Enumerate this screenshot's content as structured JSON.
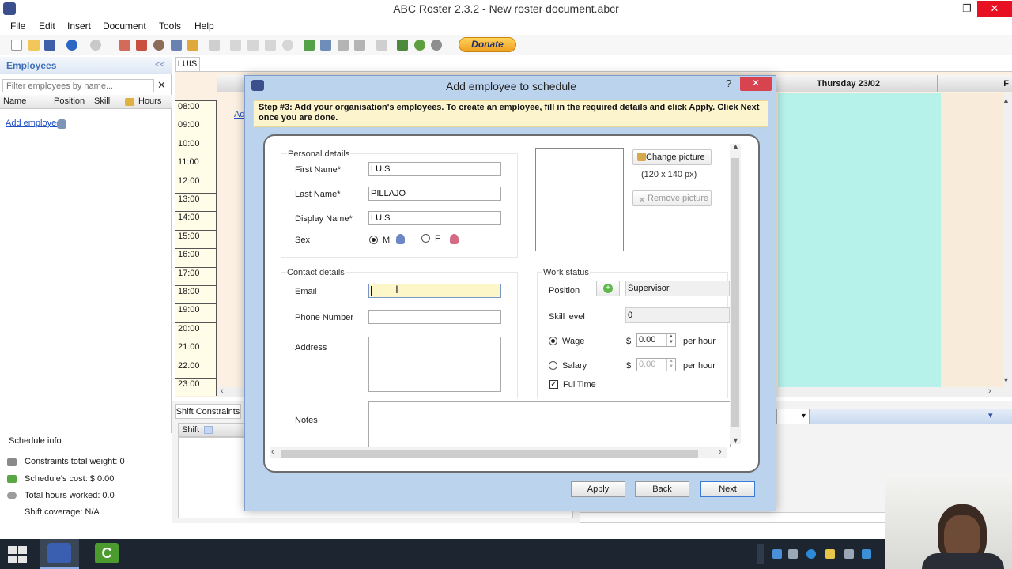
{
  "window": {
    "title": "ABC Roster 2.3.2 - New roster document.abcr",
    "minimize": "—",
    "maximize": "❐",
    "close": "✕"
  },
  "menu": [
    "File",
    "Edit",
    "Insert",
    "Document",
    "Tools",
    "Help"
  ],
  "toolbar": {
    "donate_label": "Donate"
  },
  "employees_panel": {
    "title": "Employees",
    "collapse": "<<",
    "filter_placeholder": "Filter employees by name...",
    "filter_clear": "✕",
    "columns": [
      "Name",
      "Position",
      "Skill",
      "Hours"
    ],
    "add_employee": "Add employee"
  },
  "schedule_info": {
    "title": "Schedule info",
    "constraints": "Constraints total weight: 0",
    "cost": "Schedule's cost: $ 0.00",
    "hours": "Total hours worked: 0.0",
    "coverage": "Shift coverage: N/A"
  },
  "schedule": {
    "tab": "LUIS",
    "days": {
      "thursday": "Thursday 23/02",
      "friday": "F"
    },
    "times": [
      "08:00",
      "09:00",
      "10:00",
      "11:00",
      "12:00",
      "13:00",
      "14:00",
      "15:00",
      "16:00",
      "17:00",
      "18:00",
      "19:00",
      "20:00",
      "21:00",
      "22:00",
      "23:00"
    ],
    "add_peek": "Ad"
  },
  "lower": {
    "tab": "Shift Constraints",
    "shift_header": "Shift"
  },
  "dialog": {
    "title": "Add employee to schedule",
    "help": "?",
    "close": "✕",
    "step_text": "Step #3: Add your organisation's employees.  To create an employee, fill in the required details and click Apply. Click Next once you are done.",
    "personal": {
      "title": "Personal details",
      "first_name_label": "First Name*",
      "first_name_value": "LUIS",
      "last_name_label": "Last Name*",
      "last_name_value": "PILLAJO",
      "display_name_label": "Display Name*",
      "display_name_value": "LUIS",
      "sex_label": "Sex",
      "sex_m": "M",
      "sex_f": "F",
      "sex_selected": "M"
    },
    "picture": {
      "change": "Change picture",
      "size_hint": "(120 x 140 px)",
      "remove": "Remove picture"
    },
    "contact": {
      "title": "Contact details",
      "email_label": "Email",
      "email_value": "",
      "phone_label": "Phone Number",
      "phone_value": "",
      "address_label": "Address",
      "address_value": ""
    },
    "work": {
      "title": "Work status",
      "position_label": "Position",
      "position_value": "Supervisor",
      "skill_label": "Skill level",
      "skill_value": "0",
      "wage_label": "Wage",
      "wage_currency": "$",
      "wage_value": "0.00",
      "wage_unit": "per hour",
      "salary_label": "Salary",
      "salary_currency": "$",
      "salary_value": "0.00",
      "salary_unit": "per hour",
      "pay_selected": "Wage",
      "fulltime_label": "FullTime",
      "fulltime_checked": true
    },
    "notes_label": "Notes",
    "buttons": {
      "apply": "Apply",
      "back": "Back",
      "next": "Next"
    }
  },
  "colors": {
    "accent_blue": "#3d6fb6",
    "dialog_bg": "#bcd3ee",
    "thursday_col": "#b6f1ea",
    "grid_bg": "#fbf0e2",
    "close_red": "#e81123",
    "step_bg": "#fcf4cd"
  }
}
